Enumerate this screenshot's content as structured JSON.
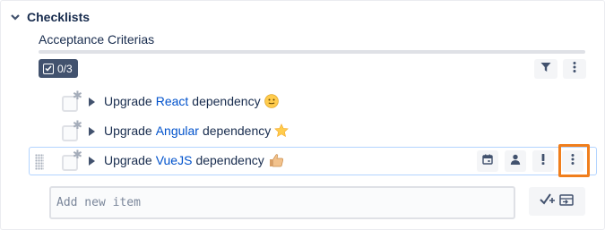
{
  "section": {
    "title": "Checklists"
  },
  "checklist": {
    "name": "Acceptance Criterias",
    "completed_fraction": 0,
    "counter": "0/3"
  },
  "items": [
    {
      "prefix": "Upgrade",
      "link": "React",
      "suffix": "dependency",
      "emoji": "slightly-smiling-face-emoji",
      "checked": false
    },
    {
      "prefix": "Upgrade",
      "link": "Angular",
      "suffix": "dependency",
      "emoji": "star-emoji",
      "checked": false
    },
    {
      "prefix": "Upgrade",
      "link": "VueJS",
      "suffix": "dependency",
      "emoji": "thumbs-up-emoji",
      "checked": false
    }
  ],
  "add_item": {
    "placeholder": "Add new item"
  },
  "icons": {
    "collapse": "chevron-down-icon",
    "filter": "filter-icon",
    "more": "more-vertical-icon",
    "due_date": "calendar-icon",
    "assignee": "person-icon",
    "priority": "exclamation-icon",
    "drag": "drag-handle-icon",
    "mandatory": "asterisk-icon",
    "expand": "triangle-right-icon",
    "add": "add-item-icon"
  },
  "colors": {
    "text": "#172b4d",
    "link": "#0052cc",
    "counter_bg": "#42526e",
    "focus_border": "#b3d4ff",
    "highlight": "#f07e1c",
    "button_bg": "#f4f5f7"
  }
}
